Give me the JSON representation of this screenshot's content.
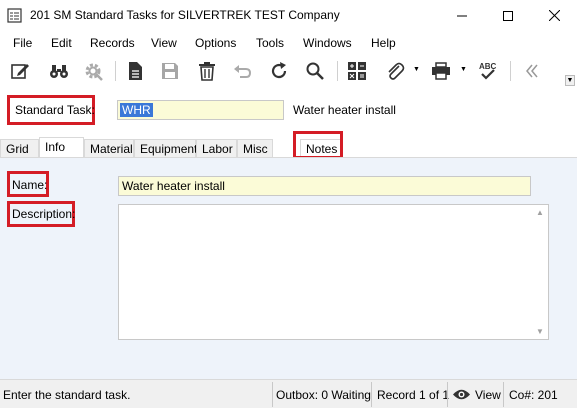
{
  "window": {
    "title": "201 SM Standard Tasks for SILVERTREK TEST Company"
  },
  "menu": [
    "File",
    "Edit",
    "Records",
    "View",
    "Options",
    "Tools",
    "Windows",
    "Help"
  ],
  "toolbar": {
    "icons": [
      "edit-icon",
      "binoculars-icon",
      "gear-icon",
      "document-icon",
      "save-icon",
      "trash-icon",
      "undo-icon",
      "refresh-icon",
      "search-icon",
      "calculator-icon",
      "paperclip-icon",
      "printer-icon",
      "spellcheck-icon",
      "collapse-icon"
    ],
    "spellcheck_text": "ABC"
  },
  "task": {
    "label": "Standard Task:",
    "value": "WHR",
    "description": "Water heater install"
  },
  "tabs": [
    "Grid",
    "Info",
    "Material",
    "Equipment",
    "Labor",
    "Misc",
    "Notes"
  ],
  "active_tab": "Info",
  "info": {
    "name_label": "Name:",
    "name_value": "Water heater install",
    "description_label": "Description:",
    "description_value": ""
  },
  "status": {
    "message": "Enter the standard task.",
    "outbox": "Outbox: 0 Waiting",
    "record": "Record 1 of 1",
    "view_label": "View",
    "company": "Co#: 201"
  },
  "colors": {
    "highlight_border": "#d41c25",
    "required_field_bg": "#fbfbd7",
    "selection_bg": "#3a78d8",
    "content_bg": "#eef3fa"
  }
}
